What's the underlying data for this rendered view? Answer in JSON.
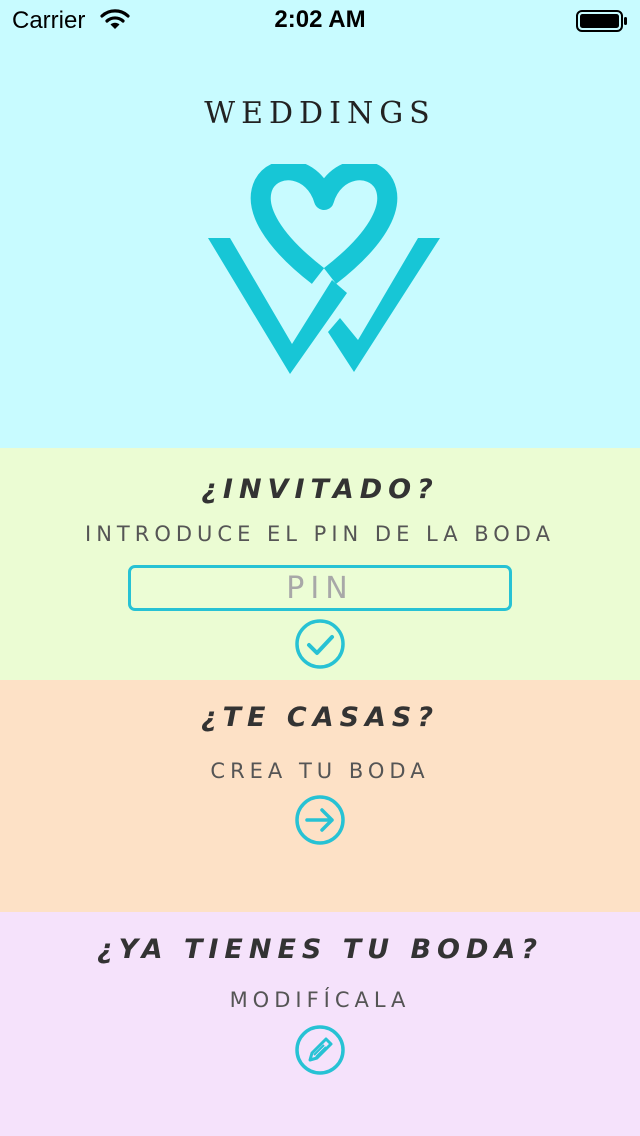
{
  "status_bar": {
    "carrier": "Carrier",
    "time": "2:02 AM"
  },
  "header": {
    "brand": "WEDDINGS",
    "logo_icon": "wedding-heart-w-logo"
  },
  "guest": {
    "title": "¿INVITADO?",
    "subtitle": "INTRODUCE EL PIN DE LA BODA",
    "pin_placeholder": "PIN",
    "pin_value": "",
    "confirm_icon": "check-circle-icon"
  },
  "create": {
    "title": "¿TE CASAS?",
    "subtitle": "CREA TU BODA",
    "go_icon": "arrow-right-circle-icon"
  },
  "modify": {
    "title": "¿YA TIENES TU BODA?",
    "subtitle": "MODIFÍCALA",
    "edit_icon": "pencil-circle-icon"
  },
  "colors": {
    "accent": "#27c2d4",
    "top_bg": "#c8fbff",
    "guest_bg": "#ebfcd3",
    "create_bg": "#fde1c6",
    "modify_bg": "#f5e2fb"
  }
}
